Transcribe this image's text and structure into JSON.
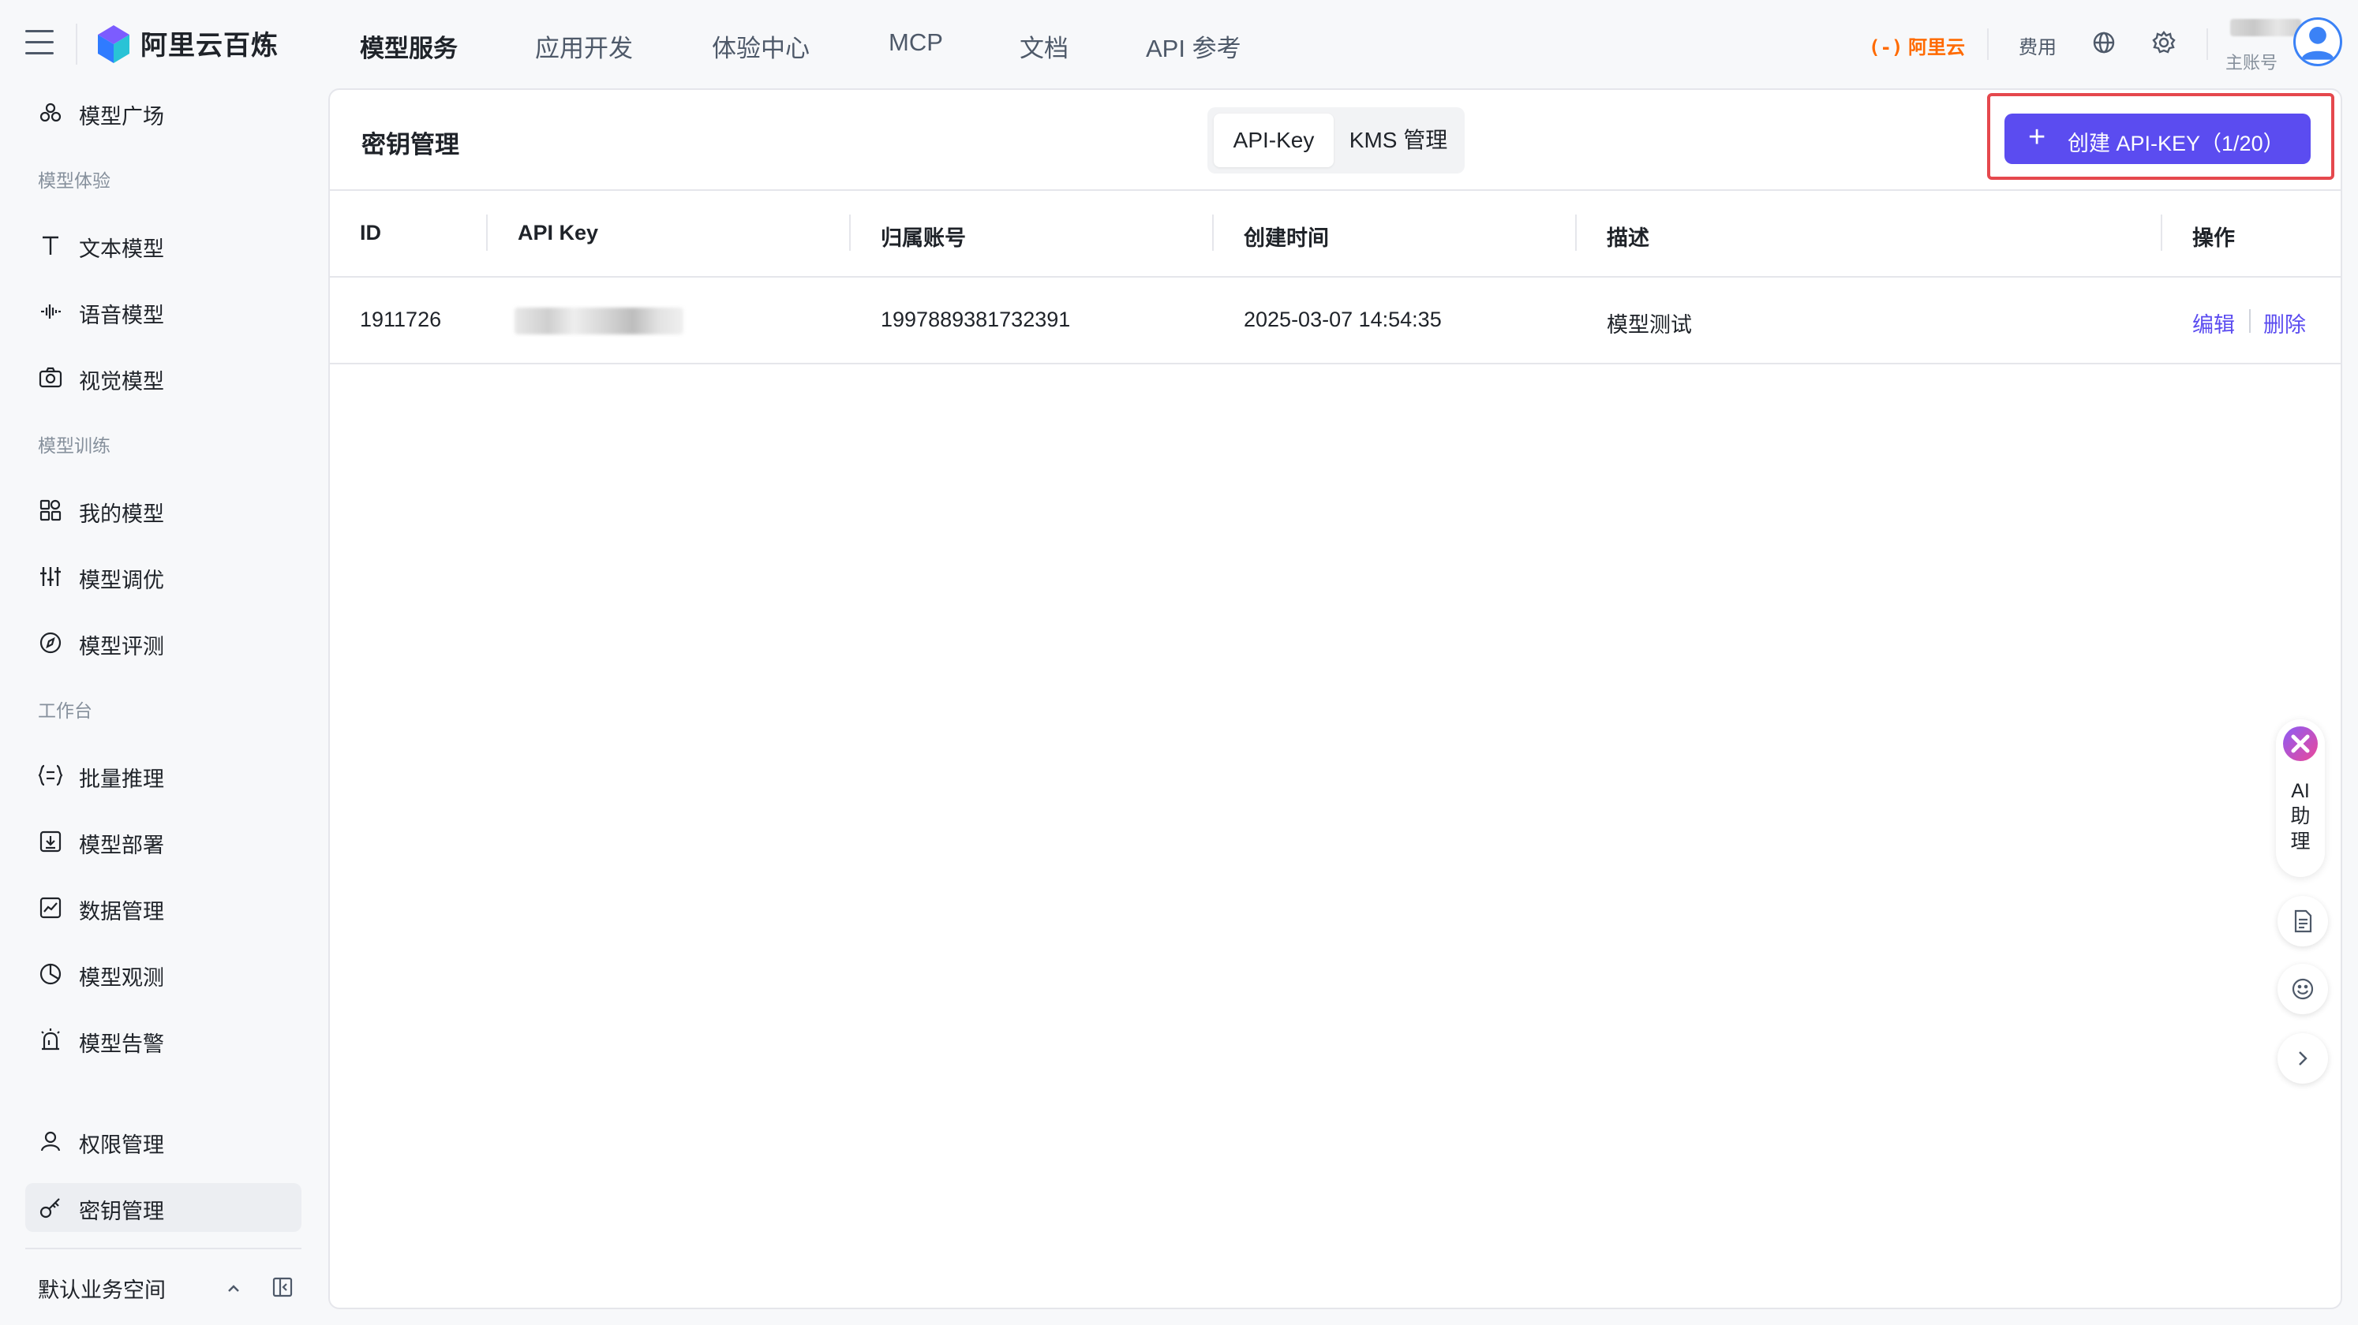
{
  "brand": {
    "name": "阿里云百炼"
  },
  "nav": {
    "items": [
      {
        "label": "模型服务",
        "active": true
      },
      {
        "label": "应用开发"
      },
      {
        "label": "体验中心"
      },
      {
        "label": "MCP"
      },
      {
        "label": "文档"
      },
      {
        "label": "API 参考"
      }
    ]
  },
  "header_right": {
    "aliyun_logo_text": "阿里云",
    "fee": "费用",
    "account_type": "主账号"
  },
  "sidebar": {
    "top_item": {
      "label": "模型广场",
      "icon": "model-square-icon"
    },
    "groups": [
      {
        "title": "模型体验",
        "items": [
          {
            "label": "文本模型",
            "icon": "text-icon"
          },
          {
            "label": "语音模型",
            "icon": "audio-wave-icon"
          },
          {
            "label": "视觉模型",
            "icon": "camera-icon"
          }
        ]
      },
      {
        "title": "模型训练",
        "items": [
          {
            "label": "我的模型",
            "icon": "apps-icon"
          },
          {
            "label": "模型调优",
            "icon": "sliders-icon"
          },
          {
            "label": "模型评测",
            "icon": "compass-icon"
          }
        ]
      },
      {
        "title": "工作台",
        "items": [
          {
            "label": "批量推理",
            "icon": "list-braces-icon"
          },
          {
            "label": "模型部署",
            "icon": "download-box-icon"
          },
          {
            "label": "数据管理",
            "icon": "chart-line-icon"
          },
          {
            "label": "模型观测",
            "icon": "pie-chart-icon"
          },
          {
            "label": "模型告警",
            "icon": "alarm-icon"
          }
        ]
      }
    ],
    "bottom_items": [
      {
        "label": "权限管理",
        "icon": "user-icon"
      },
      {
        "label": "密钥管理",
        "icon": "key-icon",
        "active": true
      }
    ],
    "workspace": "默认业务空间"
  },
  "main": {
    "title": "密钥管理",
    "tabs": [
      {
        "label": "API-Key",
        "selected": true
      },
      {
        "label": "KMS 管理"
      }
    ],
    "create_button": "创建 API-KEY（1/20）",
    "table": {
      "columns": [
        "ID",
        "API Key",
        "归属账号",
        "创建时间",
        "描述",
        "操作"
      ],
      "rows": [
        {
          "id": "1911726",
          "api_key": "",
          "account": "1997889381732391",
          "created": "2025-03-07 14:54:35",
          "description": "模型测试",
          "actions": [
            "编辑",
            "删除"
          ]
        }
      ]
    }
  },
  "assistant": {
    "label_lines": [
      "AI",
      "助",
      "理"
    ]
  },
  "colors": {
    "accent": "#5b4cf0",
    "highlight_border": "#e5484d",
    "aliyun_orange": "#ff6a00"
  }
}
